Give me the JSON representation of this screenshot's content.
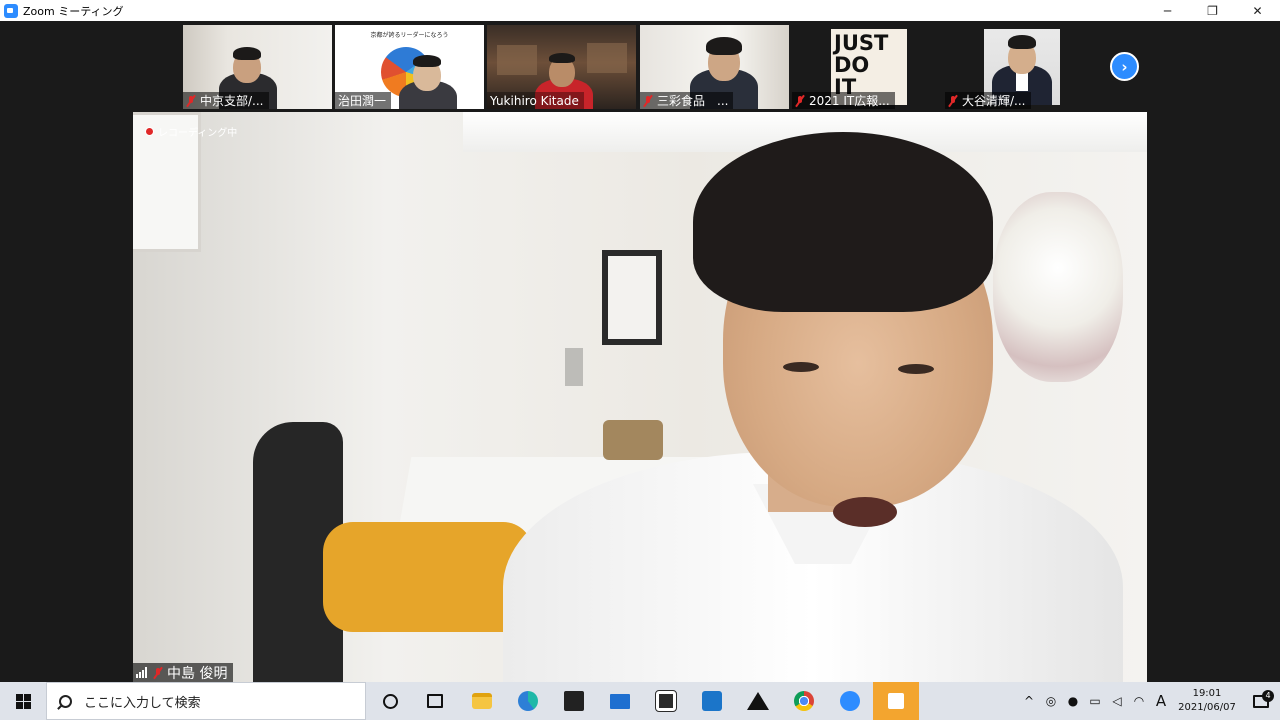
{
  "window": {
    "title": "Zoom ミーティング",
    "minimize_label": "─",
    "restore_label": "❐",
    "close_label": "✕"
  },
  "thumbnails": [
    {
      "name": "中京支部/..."
    },
    {
      "name": "治田潤一"
    },
    {
      "name": "Yukihiro Kitade"
    },
    {
      "name": "三彩食品　..."
    },
    {
      "name": "2021 IT広報..."
    },
    {
      "name": "大谷清輝/..."
    }
  ],
  "thumb_content": {
    "slide_title": "京都が誇るリーダーになろう",
    "poster_text": "JUST DO IT"
  },
  "next_button": {
    "label": "›"
  },
  "main_video": {
    "recording_label": "レコーディング中",
    "speaker_name": "中島 俊明"
  },
  "taskbar": {
    "search_placeholder": "ここに入力して検索",
    "tray_expand": "^",
    "ime_label": "A",
    "time": "19:01",
    "date": "2021/06/07",
    "notification_count": "4"
  },
  "colors": {
    "zoom_blue": "#2d8cff",
    "mute_red": "#e02828",
    "taskbar_bg": "#dfe3ea"
  }
}
